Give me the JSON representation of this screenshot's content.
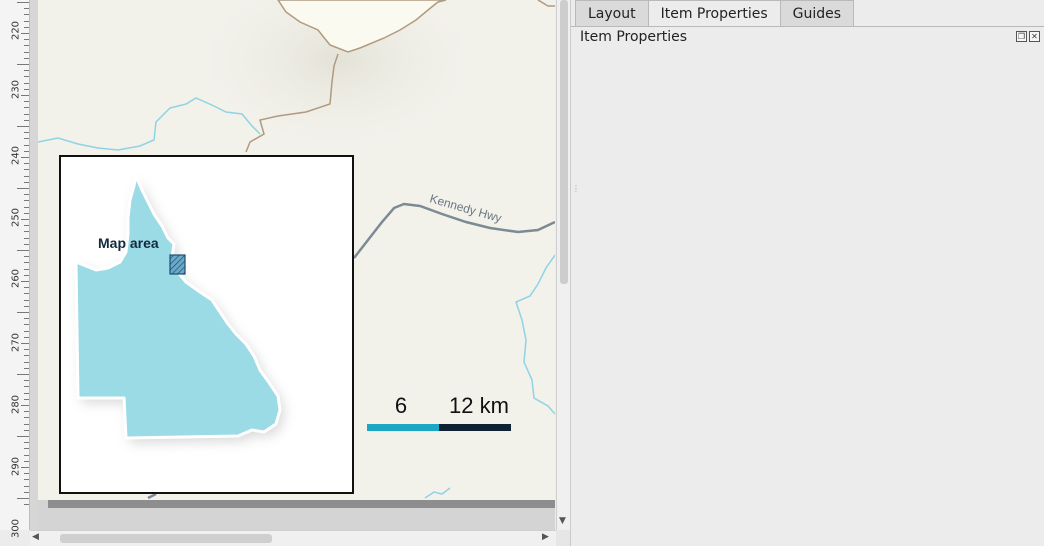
{
  "ruler": {
    "labels": [
      "220",
      "230",
      "240",
      "250",
      "260",
      "270",
      "280",
      "290",
      "300"
    ]
  },
  "map": {
    "road_label": "Kennedy Hwy",
    "inset_label": "Map area",
    "scalebar": {
      "label_mid": "6",
      "label_end": "12 km",
      "color_first": "#1aa7c4",
      "color_second": "#0e2233"
    },
    "colors": {
      "background": "#f2f1ea",
      "water": "#8fd3e6",
      "queensland_fill": "#9bdbe6",
      "boundary": "#b09a80",
      "road": "#7d8a94"
    }
  },
  "panel": {
    "tabs": [
      "Layout",
      "Item Properties",
      "Guides"
    ],
    "active_tab": "Item Properties",
    "title": "Item Properties",
    "float_icon": "float-icon",
    "close_icon": "close-icon"
  }
}
